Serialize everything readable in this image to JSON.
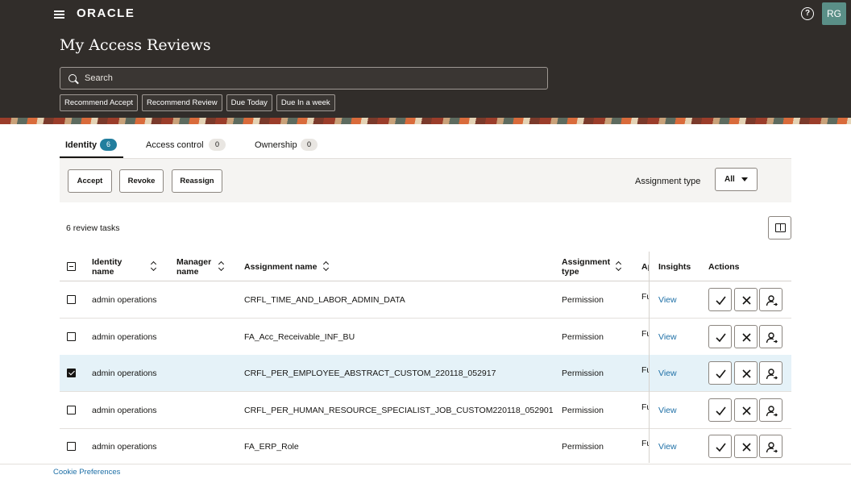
{
  "header": {
    "brand": "ORACLE",
    "page_title": "My Access Reviews",
    "user_initials": "RG",
    "help_glyph": "?",
    "search_placeholder": "Search",
    "filter_chips": [
      "Recommend Accept",
      "Recommend Review",
      "Due Today",
      "Due In a week"
    ]
  },
  "tabs": [
    {
      "label": "Identity",
      "count": "6",
      "active": true
    },
    {
      "label": "Access control",
      "count": "0",
      "active": false
    },
    {
      "label": "Ownership",
      "count": "0",
      "active": false
    }
  ],
  "toolbar": {
    "accept": "Accept",
    "revoke": "Revoke",
    "reassign": "Reassign",
    "assignment_type_label": "Assignment type",
    "assignment_type_value": "All"
  },
  "task_count": "6 review tasks",
  "table": {
    "headers": {
      "identity_name": "Identity name",
      "manager_name": "Manager name",
      "assignment_name": "Assignment name",
      "assignment_type": "Assignment type",
      "truncated": "Ap",
      "insights": "Insights",
      "actions": "Actions"
    },
    "rows": [
      {
        "identity": "admin operations",
        "manager": "",
        "assignment": "CRFL_TIME_AND_LABOR_ADMIN_DATA",
        "type": "Permission",
        "truncated": "Fu",
        "insights": "View",
        "selected": false
      },
      {
        "identity": "admin operations",
        "manager": "",
        "assignment": "FA_Acc_Receivable_INF_BU",
        "type": "Permission",
        "truncated": "Fu",
        "insights": "View",
        "selected": false
      },
      {
        "identity": "admin operations",
        "manager": "",
        "assignment": "CRFL_PER_EMPLOYEE_ABSTRACT_CUSTOM_220118_052917",
        "type": "Permission",
        "truncated": "Fu",
        "insights": "View",
        "selected": true
      },
      {
        "identity": "admin operations",
        "manager": "",
        "assignment": "CRFL_PER_HUMAN_RESOURCE_SPECIALIST_JOB_CUSTOM220118_052901",
        "type": "Permission",
        "truncated": "Fu",
        "insights": "View",
        "selected": false
      },
      {
        "identity": "admin operations",
        "manager": "",
        "assignment": "FA_ERP_Role",
        "type": "Permission",
        "truncated": "Fu",
        "insights": "View",
        "selected": false
      }
    ]
  },
  "footer": {
    "cookie": "Cookie Preferences"
  },
  "colors": {
    "header_bg": "#312d2a",
    "badge_active": "#227e9e",
    "link": "#1d6fa6",
    "selected_row": "#e5f2f8"
  }
}
